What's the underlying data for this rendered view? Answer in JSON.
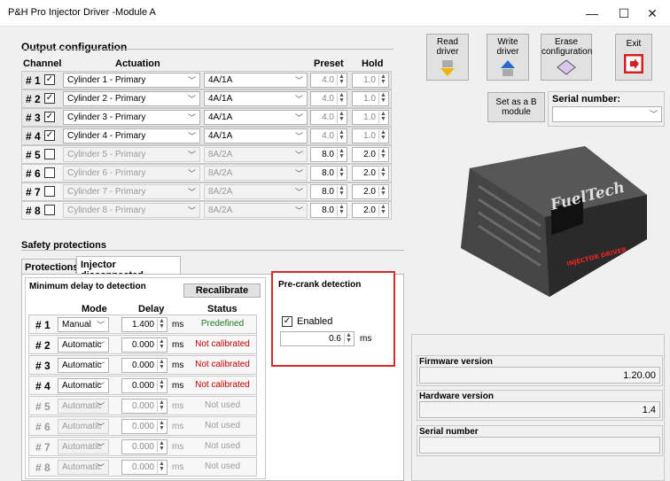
{
  "window": {
    "title": "P&H Pro Injector Driver -Module A",
    "min": "—",
    "max": "☐",
    "close": "✕"
  },
  "output": {
    "title": "Output configuration",
    "headers": {
      "channel": "Channel",
      "actuation": "Actuation",
      "preset": "Preset",
      "hold": "Hold"
    },
    "rows": [
      {
        "num": "# 1",
        "checked": "✓",
        "cyl": "Cylinder 1 - Primary",
        "amp": "4A/1A",
        "preset": "4.0",
        "hold": "1.0"
      },
      {
        "num": "# 2",
        "checked": "✓",
        "cyl": "Cylinder 2 - Primary",
        "amp": "4A/1A",
        "preset": "4.0",
        "hold": "1.0"
      },
      {
        "num": "# 3",
        "checked": "✓",
        "cyl": "Cylinder 3 - Primary",
        "amp": "4A/1A",
        "preset": "4.0",
        "hold": "1.0"
      },
      {
        "num": "# 4",
        "checked": "✓",
        "cyl": "Cylinder 4 - Primary",
        "amp": "4A/1A",
        "preset": "4.0",
        "hold": "1.0"
      },
      {
        "num": "# 5",
        "checked": "",
        "cyl": "Cylinder 5 - Primary",
        "amp": "8A/2A",
        "preset": "8.0",
        "hold": "2.0"
      },
      {
        "num": "# 6",
        "checked": "",
        "cyl": "Cylinder 6 - Primary",
        "amp": "8A/2A",
        "preset": "8.0",
        "hold": "2.0"
      },
      {
        "num": "# 7",
        "checked": "",
        "cyl": "Cylinder 7 - Primary",
        "amp": "8A/2A",
        "preset": "8.0",
        "hold": "2.0"
      },
      {
        "num": "# 8",
        "checked": "",
        "cyl": "Cylinder 8 - Primary",
        "amp": "8A/2A",
        "preset": "8.0",
        "hold": "2.0"
      }
    ]
  },
  "safety": {
    "title": "Safety protections",
    "tabs": [
      "Protections",
      "Injector disconnected"
    ],
    "min_delay": "Minimum delay to detection",
    "recalibrate": "Recalibrate",
    "headers": {
      "mode": "Mode",
      "delay": "Delay",
      "status": "Status"
    },
    "unit": "ms",
    "rows": [
      {
        "num": "# 1",
        "mode": "Manual",
        "delay": "1.400",
        "status": "Predefined",
        "color": "#1a7a1a"
      },
      {
        "num": "# 2",
        "mode": "Automatic",
        "delay": "0.000",
        "status": "Not calibrated",
        "color": "#c00000"
      },
      {
        "num": "# 3",
        "mode": "Automatic",
        "delay": "0.000",
        "status": "Not calibrated",
        "color": "#c00000"
      },
      {
        "num": "# 4",
        "mode": "Automatic",
        "delay": "0.000",
        "status": "Not calibrated",
        "color": "#c00000"
      },
      {
        "num": "# 5",
        "mode": "Automatic",
        "delay": "0.000",
        "status": "Not used",
        "color": "#999999"
      },
      {
        "num": "# 6",
        "mode": "Automatic",
        "delay": "0.000",
        "status": "Not used",
        "color": "#999999"
      },
      {
        "num": "# 7",
        "mode": "Automatic",
        "delay": "0.000",
        "status": "Not used",
        "color": "#999999"
      },
      {
        "num": "# 8",
        "mode": "Automatic",
        "delay": "0.000",
        "status": "Not used",
        "color": "#999999"
      }
    ],
    "precrank": {
      "title": "Pre-crank detection",
      "enabled_label": "Enabled",
      "value": "0.6",
      "unit": "ms"
    }
  },
  "toolbar": {
    "read": "Read driver",
    "write": "Write driver",
    "erase": "Erase configuration",
    "exit": "Exit",
    "set_b": "Set as a B module",
    "serial_label": "Serial number:"
  },
  "info": {
    "firmware_label": "Firmware version",
    "firmware": "1.20.00",
    "hardware_label": "Hardware version",
    "hardware": "1.4",
    "serial_label": "Serial number",
    "serial": ""
  },
  "device": {
    "brand": "FuelTech",
    "badge": "INJECTOR DRIVER"
  }
}
